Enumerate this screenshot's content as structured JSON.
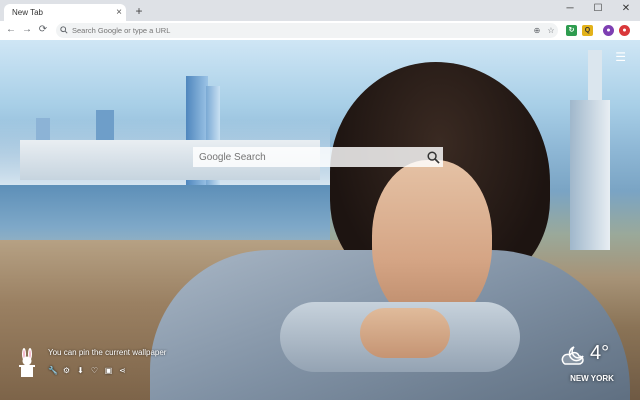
{
  "tab": {
    "title": "New Tab",
    "close": "×"
  },
  "new_tab": "+",
  "window": {
    "minimize": "─",
    "maximize": "☐",
    "close": "✕"
  },
  "nav": {
    "back": "←",
    "forward": "→",
    "reload": "⟳"
  },
  "omnibox": {
    "placeholder": "Search Google or type a URL"
  },
  "extensions": [
    {
      "name": "ext-green",
      "color": "#2e9c4f"
    },
    {
      "name": "ext-yellow",
      "color": "#e3b21a",
      "label": "Q"
    },
    {
      "name": "ext-purple",
      "color": "#7e3fb2"
    },
    {
      "name": "ext-red",
      "color": "#d9383a"
    }
  ],
  "search": {
    "placeholder": "Google Search"
  },
  "pin_message": "You can pin the current wallpaper",
  "toolbar_icons": [
    "wrench-icon",
    "gear-icon",
    "download-icon",
    "heart-icon",
    "gallery-icon",
    "share-icon"
  ],
  "weather": {
    "temperature": "4°",
    "city": "NEW YORK",
    "icon": "cloudy-night-icon"
  },
  "colors": {
    "tabstrip": "#dee1e6",
    "omnibox_bg": "#f1f3f4"
  }
}
